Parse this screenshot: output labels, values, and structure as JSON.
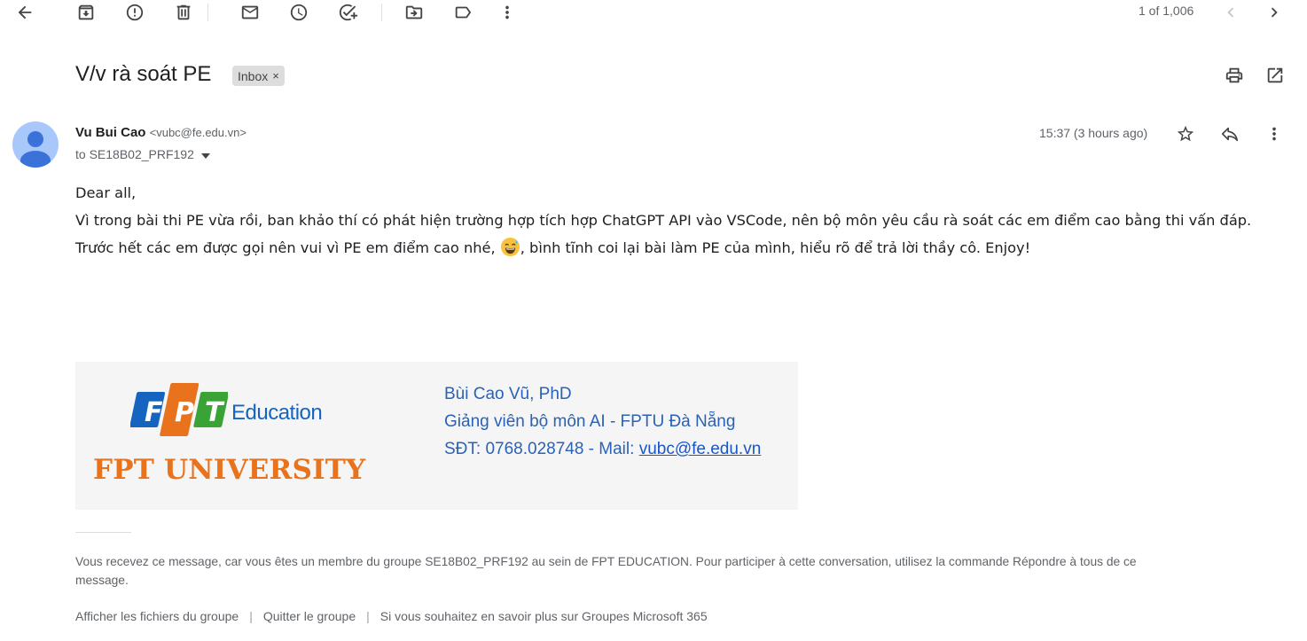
{
  "toolbar": {
    "icons": [
      "back-arrow-icon",
      "archive-icon",
      "report-spam-icon",
      "delete-icon",
      "mark-unread-icon",
      "snooze-icon",
      "add-task-icon",
      "move-to-icon",
      "label-icon",
      "more-vert-icon"
    ],
    "pager_text": "1 of 1,006"
  },
  "email": {
    "subject": "V/v rà soát PE",
    "label": "Inbox",
    "label_remove": "×",
    "sender_name": "Vu Bui Cao",
    "sender_email": "<vubc@fe.edu.vn>",
    "to_text": "to SE18B02_PRF192",
    "time": "15:37 (3 hours ago)",
    "body": {
      "line1": "Dear all,",
      "line2": "Vì trong bài thi PE vừa rồi, ban khảo thí có phát hiện trường hợp tích hợp ChatGPT API vào VSCode, nên bộ môn yêu cầu rà soát các em điểm cao bằng thi vấn đáp.",
      "line3_before": "Trước hết các em được gọi nên vui vì PE em điểm cao nhé, ",
      "line3_after": ", bình tĩnh coi lại bài làm PE của mình, hiểu rõ để trả lời thầy cô. Enjoy!"
    }
  },
  "signature": {
    "logo_letters": [
      "F",
      "P",
      "T"
    ],
    "education_text": "Education",
    "university_text": "FPT UNIVERSITY",
    "name": "Bùi Cao Vũ, PhD",
    "title": "Giảng viên bộ môn AI - FPTU Đà Nẵng",
    "contact_prefix": "SĐT: 0768.028748 - Mail: ",
    "contact_email": "vubc@fe.edu.vn",
    "colors": {
      "blue": "#1565c0",
      "orange": "#e8731c",
      "green": "#3aa335"
    }
  },
  "footer": {
    "note": "Vous recevez ce message, car vous êtes un membre du groupe SE18B02_PRF192 au sein de FPT EDUCATION. Pour participer à cette conversation, utilisez la commande Répondre à tous de ce message.",
    "links": [
      "Afficher les fichiers du groupe",
      "Quitter le groupe",
      "Si vous souhaitez en savoir plus sur Groupes Microsoft 365"
    ],
    "separator": "|"
  }
}
